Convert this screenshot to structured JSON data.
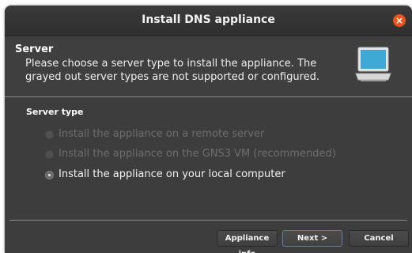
{
  "window": {
    "title": "Install DNS appliance",
    "close_glyph": "×"
  },
  "header": {
    "title": "Server",
    "description": "Please choose a server type to install the appliance. The grayed out server types are not supported or configured.",
    "icon": "monitor-icon"
  },
  "content": {
    "section_label": "Server type",
    "options": [
      {
        "label": "Install the appliance on a remote server",
        "enabled": false,
        "selected": false
      },
      {
        "label": "Install the appliance on the GNS3 VM (recommended)",
        "enabled": false,
        "selected": false
      },
      {
        "label": "Install the appliance on your local computer",
        "enabled": true,
        "selected": true
      }
    ]
  },
  "buttons": {
    "appliance_info": "Appliance info",
    "next": "Next >",
    "cancel": "Cancel"
  },
  "colors": {
    "close_button": "#e9541f",
    "background": "#3d3d3d"
  }
}
